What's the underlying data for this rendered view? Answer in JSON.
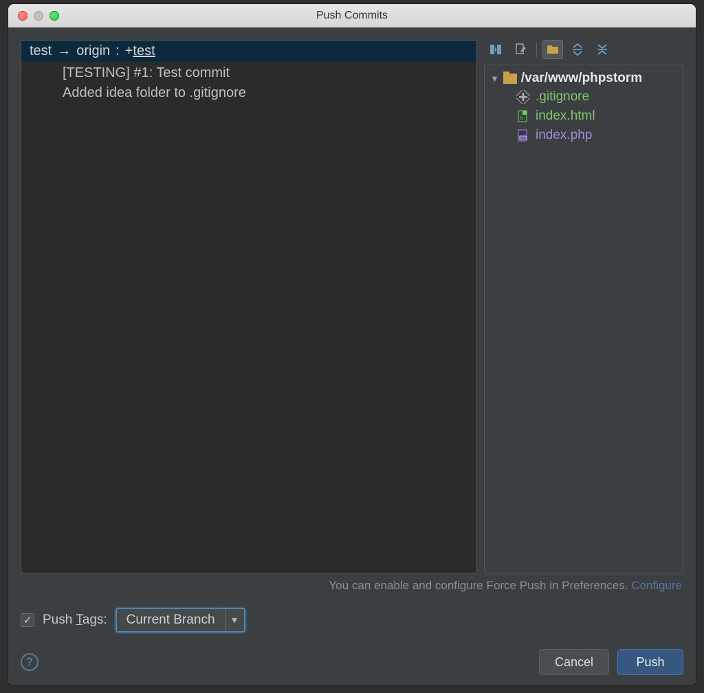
{
  "window": {
    "title": "Push Commits"
  },
  "branch": {
    "source": "test",
    "remote": "origin",
    "separator": ":",
    "target_prefix": "+",
    "target": "test"
  },
  "commits": [
    {
      "label": "[TESTING] #1: Test commit"
    },
    {
      "label": "Added idea folder to .gitignore"
    }
  ],
  "tree": {
    "root_path": "/var/www/phpstorm",
    "files": [
      {
        "name": ".gitignore",
        "status": "added",
        "icon": "diamond"
      },
      {
        "name": "index.html",
        "status": "added",
        "icon": "html"
      },
      {
        "name": "index.php",
        "status": "modified",
        "icon": "php"
      }
    ]
  },
  "hint": {
    "text": "You can enable and configure Force Push in Preferences.",
    "link": "Configure"
  },
  "tags": {
    "label_prefix": "Push ",
    "label_mnemonic": "T",
    "label_suffix": "ags:",
    "selected": "Current Branch",
    "checked": true
  },
  "buttons": {
    "cancel": "Cancel",
    "push": "Push"
  }
}
